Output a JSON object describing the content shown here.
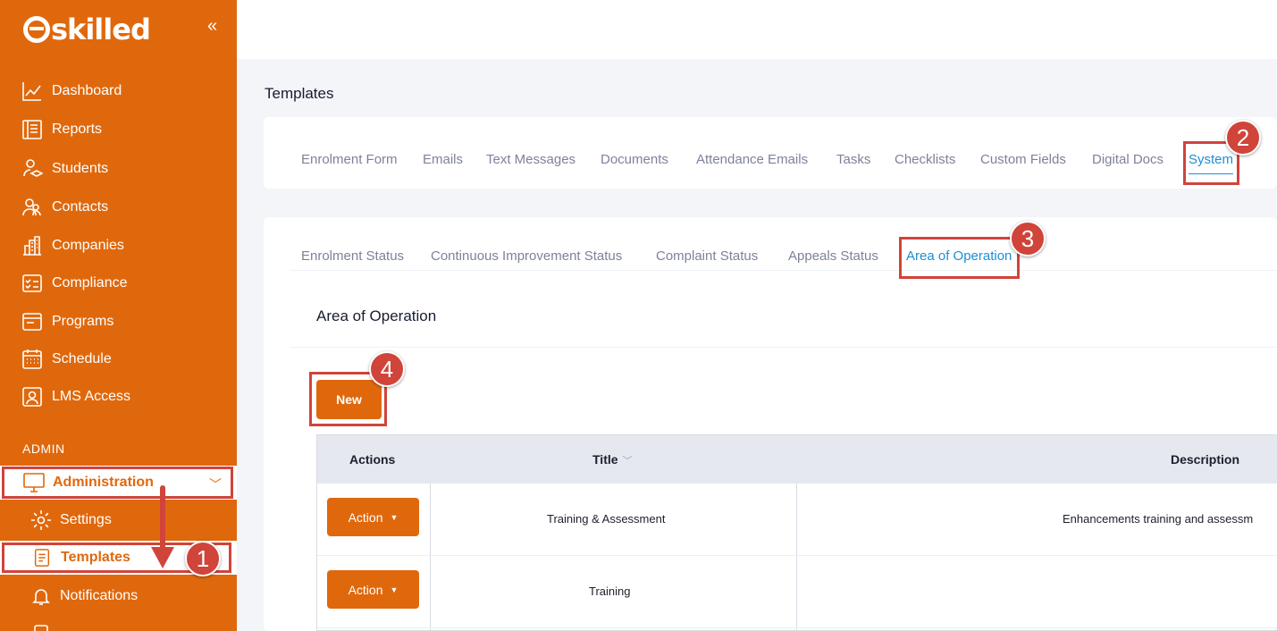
{
  "brand": {
    "logo_text": "skilled"
  },
  "sidebar": {
    "items": [
      {
        "label": "Dashboard",
        "icon": "chart-line-icon"
      },
      {
        "label": "Reports",
        "icon": "report-icon"
      },
      {
        "label": "Students",
        "icon": "students-icon"
      },
      {
        "label": "Contacts",
        "icon": "contacts-icon"
      },
      {
        "label": "Companies",
        "icon": "building-icon"
      },
      {
        "label": "Compliance",
        "icon": "checklist-icon"
      },
      {
        "label": "Programs",
        "icon": "window-icon"
      },
      {
        "label": "Schedule",
        "icon": "calendar-icon"
      },
      {
        "label": "LMS Access",
        "icon": "user-card-icon"
      }
    ],
    "admin_header": "ADMIN",
    "administration": {
      "label": "Administration",
      "icon": "monitor-icon"
    },
    "sub_items": [
      {
        "label": "Settings",
        "icon": "gear-icon"
      },
      {
        "label": "Templates",
        "icon": "document-icon"
      },
      {
        "label": "Notifications",
        "icon": "bell-icon"
      }
    ]
  },
  "page": {
    "title": "Templates"
  },
  "main_tabs": [
    "Enrolment Form",
    "Emails",
    "Text Messages",
    "Documents",
    "Attendance Emails",
    "Tasks",
    "Checklists",
    "Custom Fields",
    "Digital Docs",
    "System"
  ],
  "main_tabs_active": "System",
  "sub_tabs": [
    "Enrolment Status",
    "Continuous Improvement Status",
    "Complaint Status",
    "Appeals Status",
    "Area of Operation"
  ],
  "sub_tabs_active": "Area of Operation",
  "section": {
    "title": "Area of Operation",
    "new_button": "New"
  },
  "table": {
    "headers": {
      "actions": "Actions",
      "title": "Title",
      "description": "Description"
    },
    "rows": [
      {
        "action": "Action",
        "title": "Training & Assessment",
        "description": "Enhancements training and assessm"
      },
      {
        "action": "Action",
        "title": "Training",
        "description": ""
      }
    ]
  },
  "callouts": [
    "1",
    "2",
    "3",
    "4"
  ],
  "colors": {
    "brand_orange": "#e0680c",
    "annotation_red": "#d0443a",
    "active_tab_blue": "#1b8fd6"
  }
}
